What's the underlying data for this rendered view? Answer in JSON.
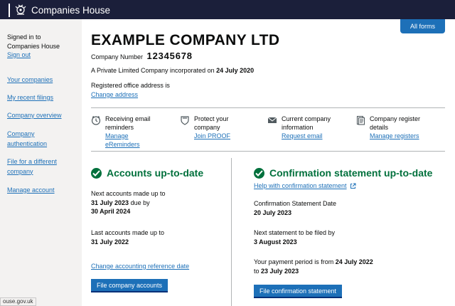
{
  "header": {
    "site_name": "Companies House"
  },
  "sidebar": {
    "signed_in_text": "Signed in to Companies House",
    "sign_out": "Sign out",
    "nav": [
      "Your companies",
      "My recent filings",
      "Company overview",
      "Company authentication",
      "File for a different company",
      "Manage account"
    ]
  },
  "main": {
    "all_forms": "All forms",
    "company_name": "EXAMPLE COMPANY LTD",
    "company_number_label": "Company Number",
    "company_number": "12345678",
    "incorporated_text": "A Private Limited Company incorporated on",
    "incorporated_date": "24 July 2020",
    "registered_office_label": "Registered office address is",
    "change_address": "Change address",
    "services": [
      {
        "icon": "clock-icon",
        "title": "Receiving email reminders",
        "link": "Manage eReminders"
      },
      {
        "icon": "shield-icon",
        "title": "Protect your company",
        "link": "Join PROOF"
      },
      {
        "icon": "envelope-icon",
        "title": "Current company information",
        "link": "Request email"
      },
      {
        "icon": "document-icon",
        "title": "Company register details",
        "link": "Manage registers"
      }
    ],
    "accounts": {
      "title": "Accounts up-to-date",
      "next_label": "Next accounts made up to",
      "next_date": "31 July 2023",
      "due_by": "due by",
      "due_date": "30 April 2024",
      "last_label": "Last accounts made up to",
      "last_date": "31 July 2022",
      "change_ref_date": "Change accounting reference date",
      "file_button": "File company accounts"
    },
    "confirmation": {
      "title": "Confirmation statement up-to-date",
      "help_link": "Help with confirmation statement",
      "date_label": "Confirmation Statement Date",
      "date": "20 July 2023",
      "next_label": "Next statement to be filed by",
      "next_date": "3 August 2023",
      "period_text": "Your payment period is from",
      "period_from": "24 July 2022",
      "period_to_word": "to",
      "period_to": "23 July 2023",
      "file_button": "File confirmation statement"
    }
  },
  "status_bar": {
    "url": "ouse.gov.uk"
  }
}
